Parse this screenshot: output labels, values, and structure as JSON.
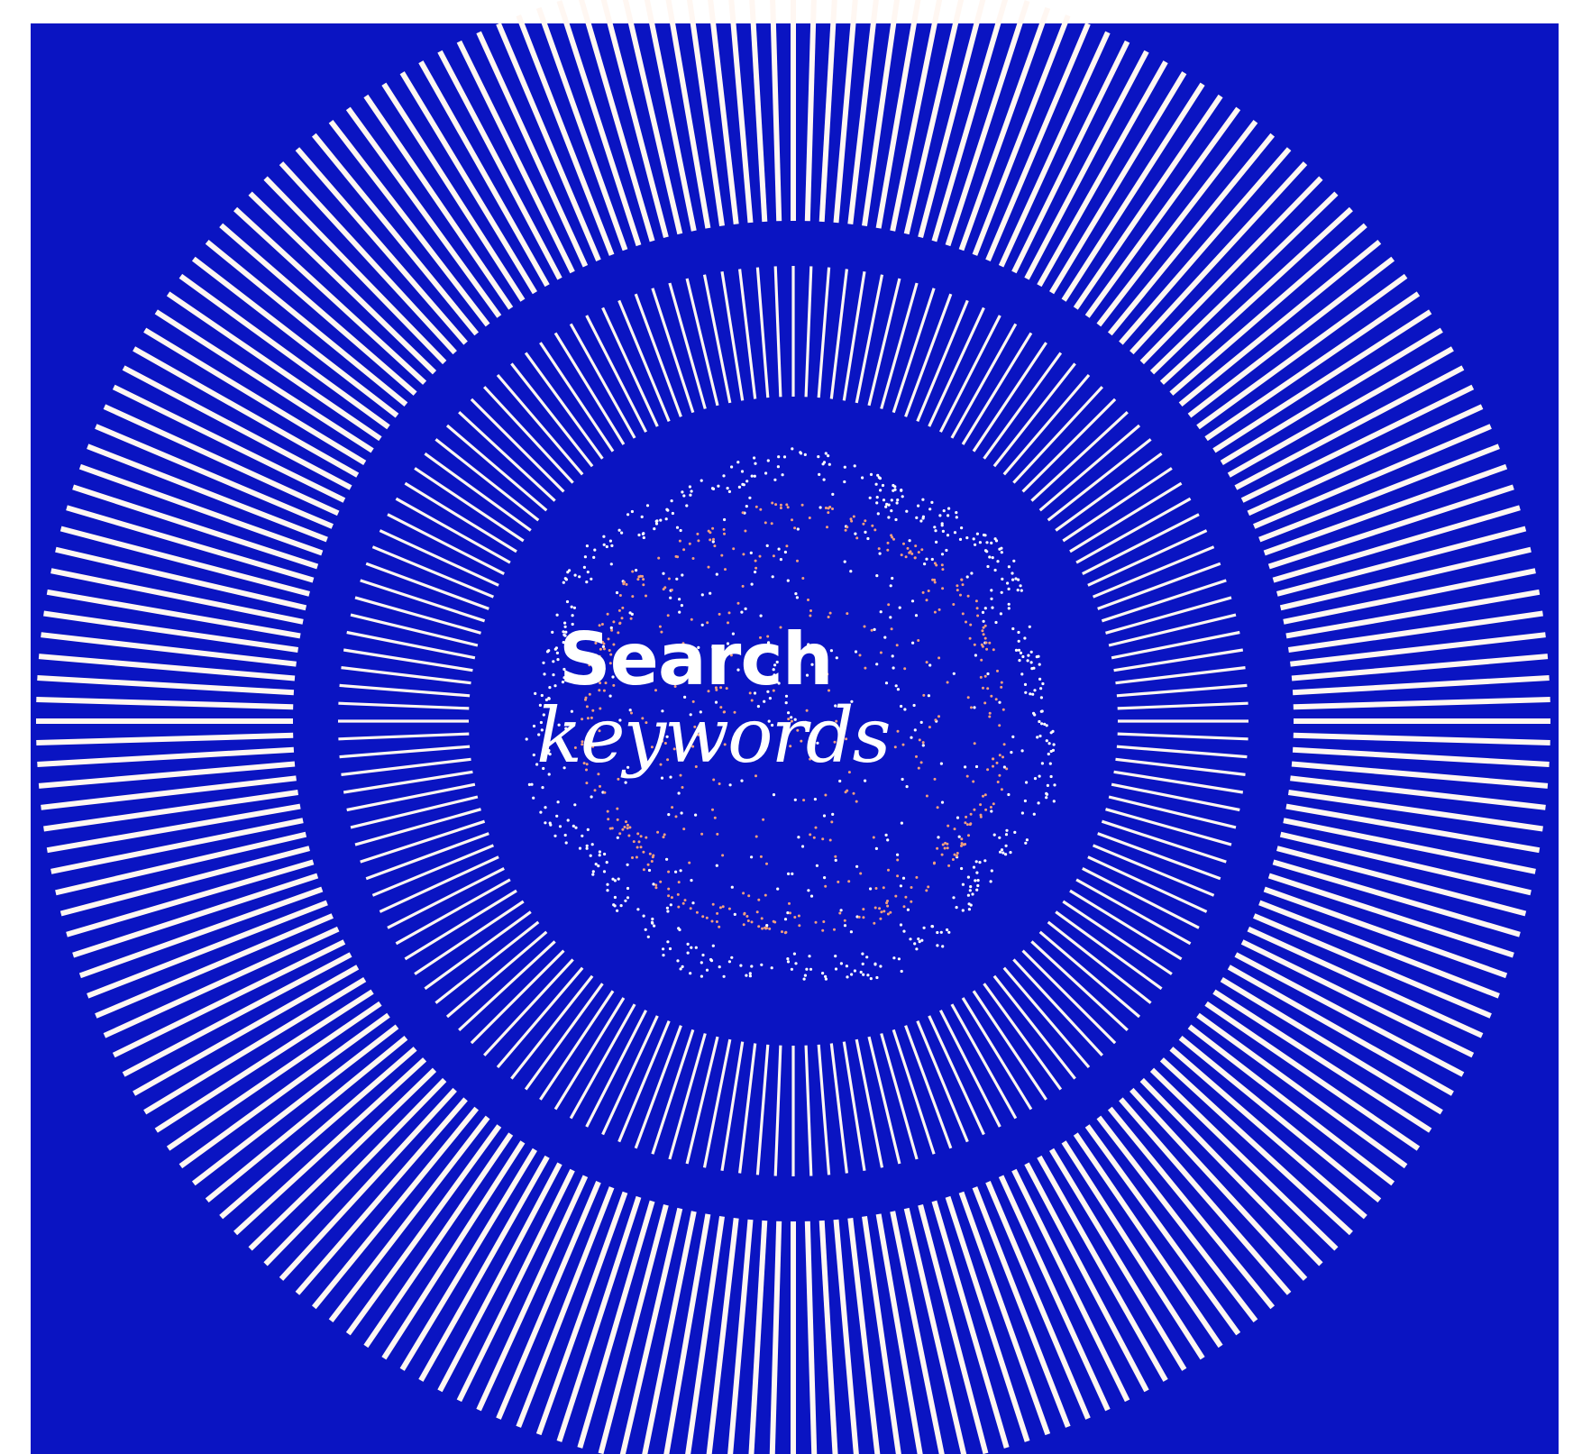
{
  "heading": {
    "line1": "Search",
    "line2": "keywords"
  },
  "colors": {
    "background": "#0a14c2",
    "page": "#ffffff",
    "rays": "#fff7f2",
    "dots_outer": "#ffffff",
    "dots_inner": "#f2a07e"
  }
}
